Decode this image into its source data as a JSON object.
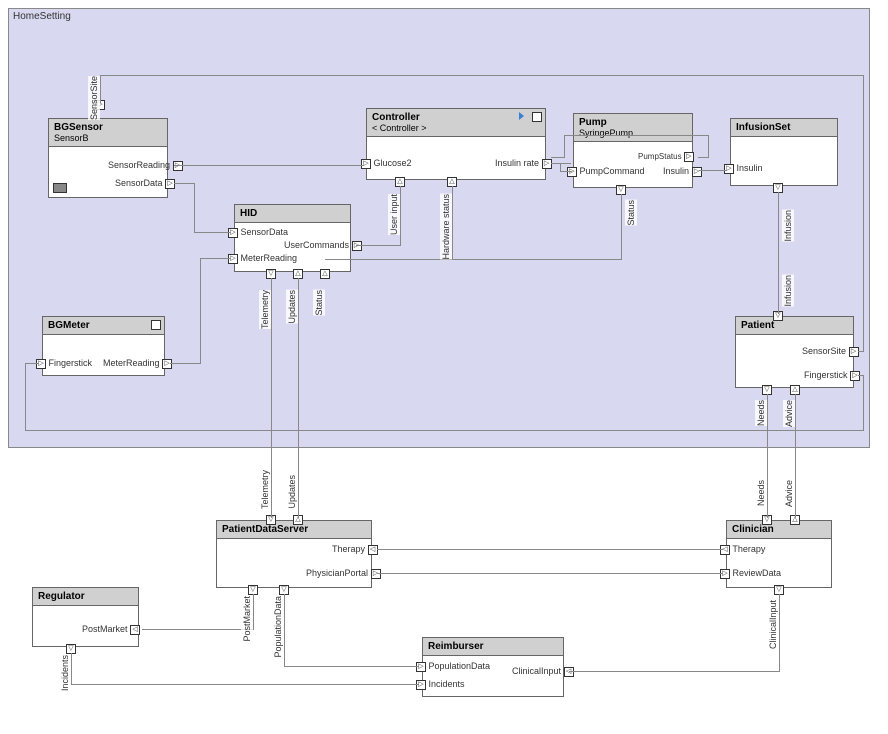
{
  "container": {
    "title": "HomeSetting"
  },
  "blocks": {
    "bgsensor": {
      "title": "BGSensor",
      "sub": "SensorB"
    },
    "controller": {
      "title": "Controller",
      "ref": "< Controller >"
    },
    "pump": {
      "title": "Pump",
      "sub": "SyringePump"
    },
    "infusionset": {
      "title": "InfusionSet"
    },
    "hid": {
      "title": "HID"
    },
    "bgmeter": {
      "title": "BGMeter"
    },
    "patient": {
      "title": "Patient"
    },
    "pds": {
      "title": "PatientDataServer"
    },
    "clinician": {
      "title": "Clinician"
    },
    "regulator": {
      "title": "Regulator"
    },
    "reimburser": {
      "title": "Reimburser"
    }
  },
  "ports": {
    "bgsensor_sensorsite": "SensorSite",
    "bgsensor_sensorreading": "SensorReading",
    "bgsensor_sensordata": "SensorData",
    "controller_glucose2": "Glucose2",
    "controller_insulinrate": "Insulin rate",
    "controller_userinput": "User input",
    "controller_hwstatus": "Hardware status",
    "pump_pumpstatus": "PumpStatus",
    "pump_pumpcommand": "PumpCommand",
    "pump_insulin": "Insulin",
    "pump_status": "Status",
    "infusionset_insulin": "Insulin",
    "hid_sensordata": "SensorData",
    "hid_usercommands": "UserCommands",
    "hid_meterreading": "MeterReading",
    "hid_telemetry": "Telemetry",
    "hid_updates": "Updates",
    "hid_status": "Status",
    "bgmeter_fingerstick": "Fingerstick",
    "bgmeter_meterreading": "MeterReading",
    "patient_sensorsite": "SensorSite",
    "patient_fingerstick": "Fingerstick",
    "patient_needs": "Needs",
    "patient_advice": "Advice",
    "pds_therapy": "Therapy",
    "pds_physportal": "PhysicianPortal",
    "pds_postmarket": "PostMarket",
    "pds_popdata": "PopulationData",
    "clinician_therapy": "Therapy",
    "clinician_reviewdata": "ReviewData",
    "clinician_clinicalinput": "ClinicalInput",
    "clinician_needs": "Needs",
    "clinician_advice": "Advice",
    "regulator_postmarket": "PostMarket",
    "regulator_incidents": "Incidents",
    "reimburser_popdata": "PopulationData",
    "reimburser_incidents": "Incidents",
    "reimburser_clinicalinput": "ClinicalInput"
  },
  "labels": {
    "infusion1": "Infusion",
    "infusion2": "Infusion",
    "telemetry": "Telemetry",
    "updates": "Updates",
    "needs": "Needs",
    "advice": "Advice"
  }
}
